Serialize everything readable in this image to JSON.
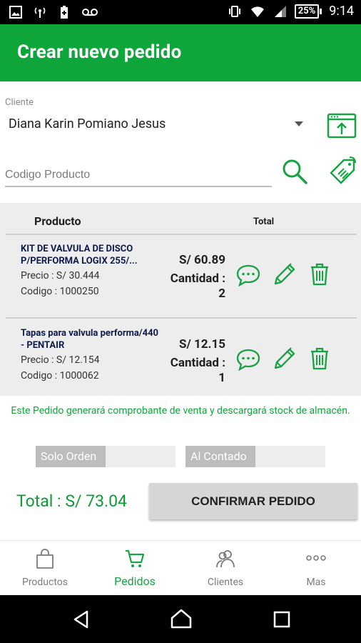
{
  "status_bar": {
    "battery": "25%",
    "time": "9:14"
  },
  "app_bar": {
    "title": "Crear nuevo pedido"
  },
  "cliente": {
    "label": "Cliente",
    "value": "Diana Karin Pomiano Jesus"
  },
  "search": {
    "placeholder": "Codigo Producto"
  },
  "table": {
    "header_producto": "Producto",
    "header_total": "Total",
    "rows": [
      {
        "name": "KIT DE VALVULA DE DISCO P/PERFORMA LOGIX 255/...",
        "precio": "Precio : S/ 30.444",
        "codigo": "Codigo : 1000250",
        "total": "S/ 60.89",
        "cantidad_label": "Cantidad :",
        "cantidad": "2"
      },
      {
        "name": "Tapas para valvula performa/440 - PENTAIR",
        "precio": "Precio : S/ 12.154",
        "codigo": "Codigo : 1000062",
        "total": "S/ 12.15",
        "cantidad_label": "Cantidad :",
        "cantidad": "1"
      }
    ]
  },
  "note": "Este Pedido generará comprobante de venta y descargará stock de almacén.",
  "toggles": {
    "solo_orden": "Solo Orden",
    "al_contado": "Al Contado"
  },
  "footer": {
    "total": "Total : S/ 73.04",
    "confirm_label": "CONFIRMAR PEDIDO"
  },
  "bottom_nav": {
    "items": [
      {
        "label": "Productos"
      },
      {
        "label": "Pedidos"
      },
      {
        "label": "Clientes"
      },
      {
        "label": "Mas"
      }
    ]
  },
  "colors": {
    "brand_green": "#0ea53b",
    "icon_green": "#17a344"
  }
}
